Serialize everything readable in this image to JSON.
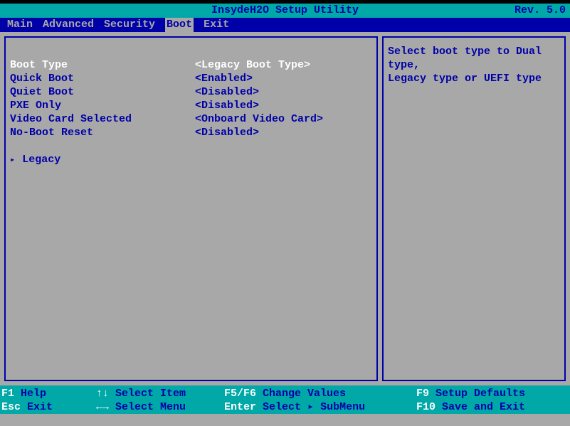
{
  "title": "InsydeH2O Setup Utility",
  "revision": "Rev. 5.0",
  "menu": {
    "items": [
      "Main",
      "Advanced",
      "Security",
      "Boot",
      "Exit"
    ],
    "active_index": 3
  },
  "settings": [
    {
      "label": "Boot Type",
      "value": "<Legacy Boot Type>",
      "selected": true
    },
    {
      "label": "Quick Boot",
      "value": "<Enabled>",
      "selected": false
    },
    {
      "label": "Quiet Boot",
      "value": "<Disabled>",
      "selected": false
    },
    {
      "label": "PXE Only",
      "value": "<Disabled>",
      "selected": false
    },
    {
      "label": "Video Card Selected",
      "value": "<Onboard Video Card>",
      "selected": false
    },
    {
      "label": "No-Boot Reset",
      "value": "<Disabled>",
      "selected": false
    }
  ],
  "submenu": {
    "label": "Legacy"
  },
  "help": {
    "line1": "Select boot type to Dual type,",
    "line2": "Legacy type or UEFI type"
  },
  "footer": {
    "r1": {
      "k1": "F1",
      "l1": "Help",
      "a2": "↑↓",
      "l2": "Select Item",
      "k3": "F5/F6",
      "l3": "Change Values",
      "k4": "F9",
      "l4": "Setup Defaults"
    },
    "r2": {
      "k1": "Esc",
      "l1": "Exit",
      "a2": "←→",
      "l2": "Select Menu",
      "k3": "Enter",
      "l3": "Select ▸ SubMenu",
      "k4": "F10",
      "l4": "Save and Exit"
    }
  }
}
